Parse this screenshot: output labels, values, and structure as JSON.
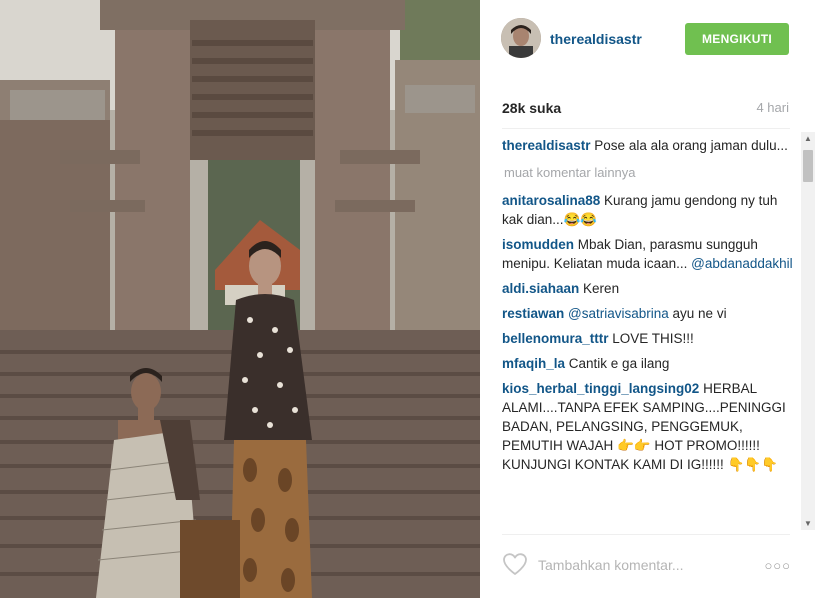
{
  "post": {
    "username": "therealdisastr",
    "follow_label": "MENGIKUTI",
    "likes": "28k suka",
    "age": "4 hari",
    "load_more": "muat komentar lainnya",
    "add_comment_placeholder": "Tambahkan komentar...",
    "more_options": "○○○"
  },
  "caption": {
    "user": "therealdisastr",
    "text": " Pose ala ala orang jaman dulu..."
  },
  "comments": [
    {
      "user": "anitarosalina88",
      "text": " Kurang jamu gendong ny tuh kak dian...😂😂"
    },
    {
      "user": "isomudden",
      "text": " Mbak Dian, parasmu sungguh menipu. Keliatan muda icaan... ",
      "mention": "@abdanaddakhil"
    },
    {
      "user": "aldi.siahaan",
      "text": " Keren"
    },
    {
      "user": "restiawan",
      "mention_first": " @satriavisabrina",
      "text": " ayu ne vi"
    },
    {
      "user": "bellenomura_tttr",
      "text": " LOVE THIS!!!"
    },
    {
      "user": "mfaqih_la",
      "text": " Cantik e ga ilang"
    },
    {
      "user": "kios_herbal_tinggi_langsing02",
      "text": " HERBAL ALAMI....TANPA EFEK SAMPING....PENINGGI BADAN, PELANGSING, PENGGEMUK, PEMUTIH WAJAH 👉👉 HOT PROMO!!!!!! KUNJUNGI KONTAK KAMI DI IG!!!!!! 👇👇👇"
    }
  ],
  "icons": {
    "like": "heart-outline-icon",
    "more": "ellipsis-icon",
    "scroll_up": "triangle-up-icon",
    "scroll_down": "triangle-down-icon"
  },
  "colors": {
    "username": "#125688",
    "follow_button": "#70c050",
    "muted": "#a5a7aa"
  }
}
